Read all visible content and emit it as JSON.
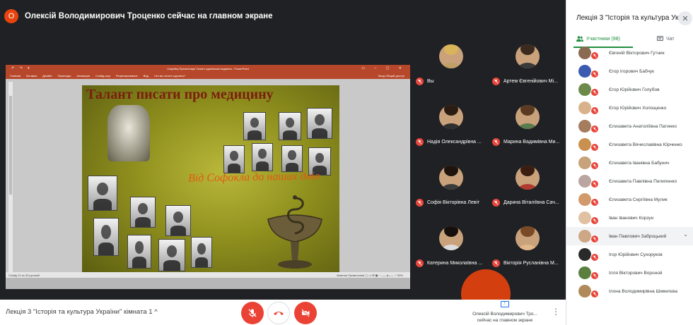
{
  "header": {
    "presenter_initial": "О",
    "title": "Олексій Володимирович Троценко сейчас на главном экране"
  },
  "ppt": {
    "window_title": "Скарбец Презентація Талант українське видання - PowerPoint",
    "ribbon_tabs": [
      "Главная",
      "Вставка",
      "Дизайн",
      "Переходы",
      "Анимация",
      "Слайд-шоу",
      "Рецензирование",
      "Вид",
      "Что вы хотите сделать?"
    ],
    "share_label": "Вход  Общий доступ",
    "status_left": "Слайд 10 из 25   русский",
    "status_right": "Заметки   Примечания   ▢  ▭  ⊞  ▣   −  ——●——  +  55%",
    "slide_title": "Талант писати про медицину",
    "slide_subtitle": "Від Софокла до наших днів"
  },
  "tiles": [
    {
      "name": "Вы",
      "hair": "#d9b45a",
      "shirt": "#bfa066"
    },
    {
      "name": "Артем Євгенійович Мі...",
      "hair": "#3b2a1d",
      "shirt": "#3a3a3a"
    },
    {
      "name": "Надія Олександрівна ...",
      "hair": "#2b1c12",
      "shirt": "#2f2f2f"
    },
    {
      "name": "Марина Вадимівна Ми...",
      "hair": "#5a3b21",
      "shirt": "#5b7c4f"
    },
    {
      "name": "Софія Вікторівна Левіт",
      "hair": "#1f140d",
      "shirt": "#3b3b3b"
    },
    {
      "name": "Дарина Віталіївна Сач...",
      "hair": "#3a1d10",
      "shirt": "#b23b2f"
    },
    {
      "name": "Катерина Миколаївна ...",
      "hair": "#160f0b",
      "shirt": "#dcdcdc"
    },
    {
      "name": "Вікторія Русланівна М...",
      "hair": "#7a4a27",
      "shirt": "#e2b78c"
    }
  ],
  "bottom": {
    "meeting_name": "Лекція 3 \"Історія та культура України\" кімната 1",
    "presenting_line1": "Олексій Володимирович Тро...",
    "presenting_line2": "сейчас на главном экране"
  },
  "panel": {
    "title": "Лекція 3 \"Історія та культура Ук...",
    "tab_people": "Участники (98)",
    "tab_chat": "Чат",
    "participants": [
      {
        "name": "Євгеній Вікторович Гутник",
        "color": "#8a6b52"
      },
      {
        "name": "Єгор Ігорович Бабчук",
        "color": "#3b5bb0"
      },
      {
        "name": "Єгор Юрійович Голубов",
        "color": "#6d8a4a"
      },
      {
        "name": "Єгор Юрійович Холощенко",
        "color": "#d9b28c"
      },
      {
        "name": "Єлизавета Анатоліївна Патинко",
        "color": "#a67c5e"
      },
      {
        "name": "Єлизавета Вячеславівна Юрченко",
        "color": "#c9904f"
      },
      {
        "name": "Єлизавета Іванівна Бабунич",
        "color": "#c7a27a"
      },
      {
        "name": "Єлизавета Павлівна Пилипенко",
        "color": "#b9a6a0"
      },
      {
        "name": "Єлизавета Сергіївна Мулик",
        "color": "#d29a6b"
      },
      {
        "name": "Іван Іванович Корзун",
        "color": "#e0c1a2"
      },
      {
        "name": "Іван Павлович Заброцький",
        "color": "#cda786"
      },
      {
        "name": "Ігор Юрійович Сухоруков",
        "color": "#2a2a2a"
      },
      {
        "name": "Ілля Вікторович Вороной",
        "color": "#5a7f3f"
      },
      {
        "name": "Ілона Володимирівна Шевелєва",
        "color": "#b08a5a"
      }
    ]
  },
  "colors": {
    "accent": "#1e8e3e",
    "danger": "#ea4335",
    "ppt": "#b7472a"
  }
}
